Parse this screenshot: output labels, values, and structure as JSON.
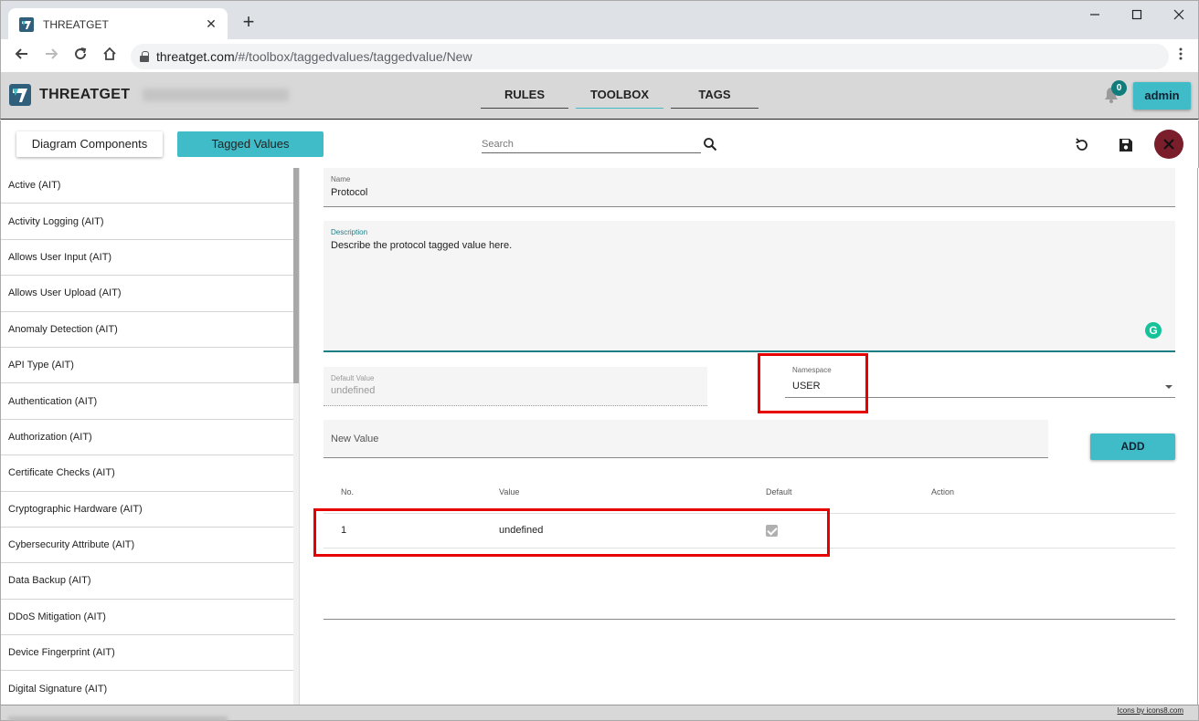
{
  "browser": {
    "tab_title": "THREATGET",
    "tab_close": "✕",
    "new_tab": "+",
    "url_host": "threatget.com",
    "url_path": "/#/toolbox/taggedvalues/taggedvalue/New"
  },
  "header": {
    "brand": "THREATGET",
    "nav": [
      "RULES",
      "TOOLBOX",
      "TAGS"
    ],
    "active_nav": "TOOLBOX",
    "notification_count": "0",
    "user_button": "admin"
  },
  "toolbar": {
    "diagram_components": "Diagram Components",
    "tagged_values": "Tagged Values",
    "search_placeholder": "Search"
  },
  "sidebar": {
    "items": [
      "Active (AIT)",
      "Activity Logging (AIT)",
      "Allows User Input (AIT)",
      "Allows User Upload (AIT)",
      "Anomaly Detection (AIT)",
      "API Type (AIT)",
      "Authentication (AIT)",
      "Authorization (AIT)",
      "Certificate Checks (AIT)",
      "Cryptographic Hardware (AIT)",
      "Cybersecurity Attribute (AIT)",
      "Data Backup (AIT)",
      "DDoS Mitigation (AIT)",
      "Device Fingerprint (AIT)",
      "Digital Signature (AIT)"
    ]
  },
  "form": {
    "name_label": "Name",
    "name_value": "Protocol",
    "description_label": "Description",
    "description_value": "Describe the protocol tagged value here.",
    "default_label": "Default Value",
    "default_value": "undefined",
    "namespace_label": "Namespace",
    "namespace_value": "USER",
    "new_value_placeholder": "New Value",
    "add_button": "ADD"
  },
  "table": {
    "headers": [
      "No.",
      "Value",
      "Default",
      "Action"
    ],
    "rows": [
      {
        "no": "1",
        "value": "undefined",
        "default": true
      }
    ]
  },
  "footer": {
    "credit": "Icons by icons8.com"
  },
  "colors": {
    "accent": "#3fbcc8",
    "close_button": "#7b1e2b",
    "highlight": "#e60000"
  }
}
